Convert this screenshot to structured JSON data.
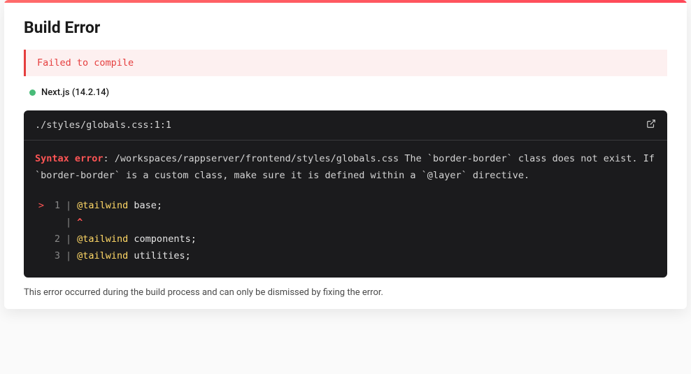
{
  "title": "Build Error",
  "alert": {
    "text": "Failed to compile"
  },
  "framework": {
    "status": "running",
    "label": "Next.js (14.2.14)"
  },
  "code": {
    "file_location": "./styles/globals.css:1:1",
    "error_label": "Syntax error",
    "error_message": ": /workspaces/rappserver/frontend/styles/globals.css The `border-border` class does not exist. If `border-border` is a custom class, make sure it is defined within a `@layer` directive.",
    "lines": [
      {
        "pointer": "> ",
        "num": "1",
        "kw": "@tailwind",
        "rest": " base;"
      },
      {
        "pointer": "  ",
        "num": " ",
        "kw": "^",
        "rest": "",
        "caret": true
      },
      {
        "pointer": "  ",
        "num": "2",
        "kw": "@tailwind",
        "rest": " components;"
      },
      {
        "pointer": "  ",
        "num": "3",
        "kw": "@tailwind",
        "rest": " utilities;"
      }
    ]
  },
  "footer": {
    "note": "This error occurred during the build process and can only be dismissed by fixing the error."
  }
}
